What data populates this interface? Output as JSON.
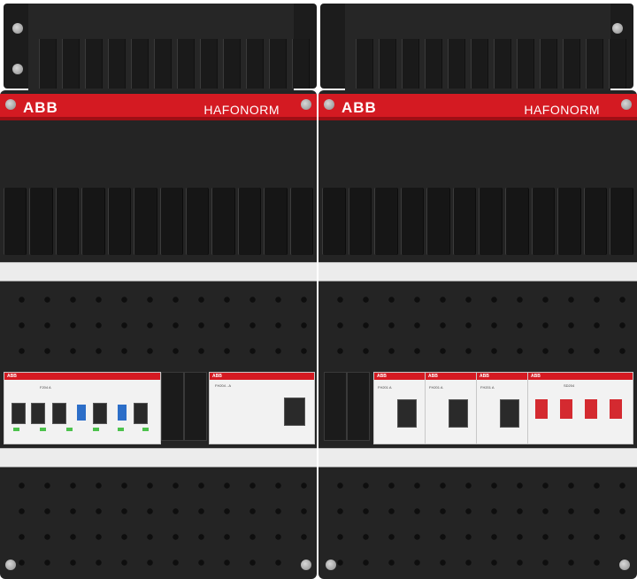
{
  "left_panel": {
    "brand": "ABB",
    "label": "HAFONORM",
    "devices": [
      {
        "header": "ABB",
        "text": "F204 A"
      },
      {
        "header": "ABB",
        "text": "DS201"
      },
      {
        "header": "ABB",
        "text": "FH204 - A"
      }
    ]
  },
  "right_panel": {
    "brand": "ABB",
    "label": "HAFONORM",
    "devices": [
      {
        "header": "ABB",
        "text": "FH201 A"
      },
      {
        "header": "ABB",
        "text": "FH201 A"
      },
      {
        "header": "ABB",
        "text": "FH201 A"
      },
      {
        "header": "ABB",
        "text": "SD204"
      }
    ]
  },
  "colors": {
    "panel": "#242424",
    "brand_red": "#d41a22",
    "rail": "#ececec",
    "toggle_green": "#4cc24c",
    "toggle_blue": "#2c6ec8"
  }
}
